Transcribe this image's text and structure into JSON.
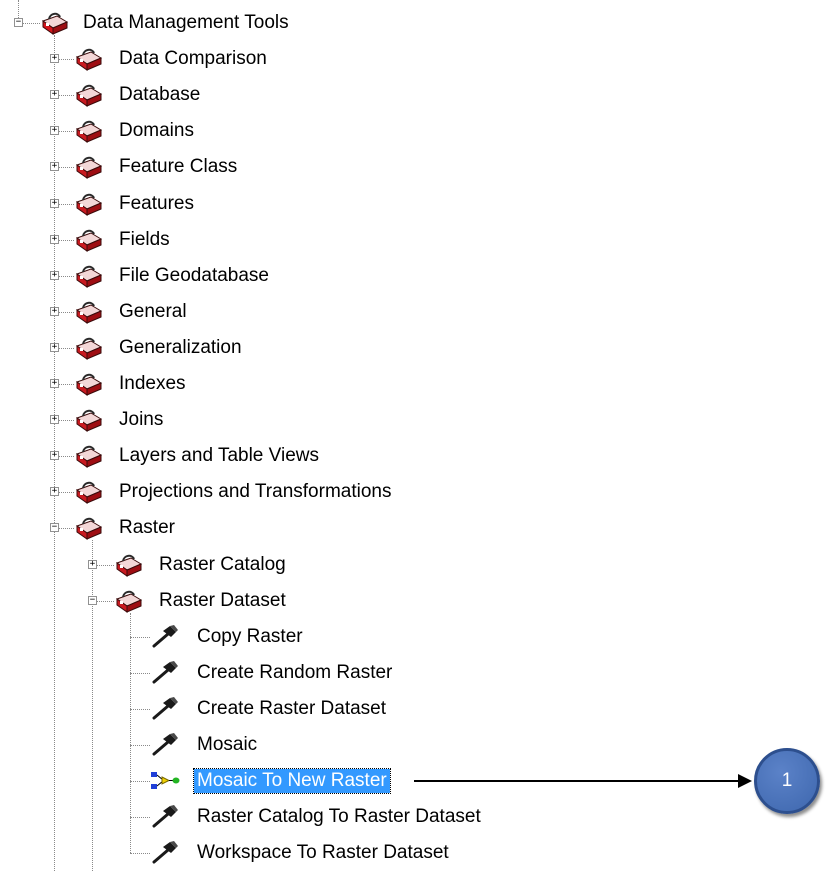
{
  "tree": {
    "root": {
      "label": "Data Management Tools",
      "expanded": true,
      "icon": "red-toolbox-icon"
    },
    "toolsets": [
      {
        "label": "Data Comparison",
        "expanded": false
      },
      {
        "label": "Database",
        "expanded": false
      },
      {
        "label": "Domains",
        "expanded": false
      },
      {
        "label": "Feature Class",
        "expanded": false
      },
      {
        "label": "Features",
        "expanded": false
      },
      {
        "label": "Fields",
        "expanded": false
      },
      {
        "label": "File Geodatabase",
        "expanded": false
      },
      {
        "label": "General",
        "expanded": false
      },
      {
        "label": "Generalization",
        "expanded": false
      },
      {
        "label": "Indexes",
        "expanded": false
      },
      {
        "label": "Joins",
        "expanded": false
      },
      {
        "label": "Layers and Table Views",
        "expanded": false
      },
      {
        "label": "Projections and Transformations",
        "expanded": false
      },
      {
        "label": "Raster",
        "expanded": true
      }
    ],
    "raster_children": [
      {
        "label": "Raster Catalog",
        "expanded": false
      },
      {
        "label": "Raster Dataset",
        "expanded": true
      }
    ],
    "raster_dataset_tools": [
      {
        "label": "Copy Raster",
        "icon": "hammer-icon",
        "selected": false
      },
      {
        "label": "Create Random Raster",
        "icon": "hammer-icon",
        "selected": false
      },
      {
        "label": "Create Raster Dataset",
        "icon": "hammer-icon",
        "selected": false
      },
      {
        "label": "Mosaic",
        "icon": "hammer-icon",
        "selected": false
      },
      {
        "label": "Mosaic To New Raster",
        "icon": "model-icon",
        "selected": true
      },
      {
        "label": "Raster Catalog To Raster Dataset",
        "icon": "hammer-icon",
        "selected": false
      },
      {
        "label": "Workspace To Raster Dataset",
        "icon": "hammer-icon",
        "selected": false
      }
    ],
    "expand_symbol": "+",
    "collapse_symbol": "−"
  },
  "callout": {
    "number": "1"
  },
  "colors": {
    "selection": "#3399ff",
    "callout_fill": "#4f75bd",
    "toolbox_red": "#c0141a"
  }
}
